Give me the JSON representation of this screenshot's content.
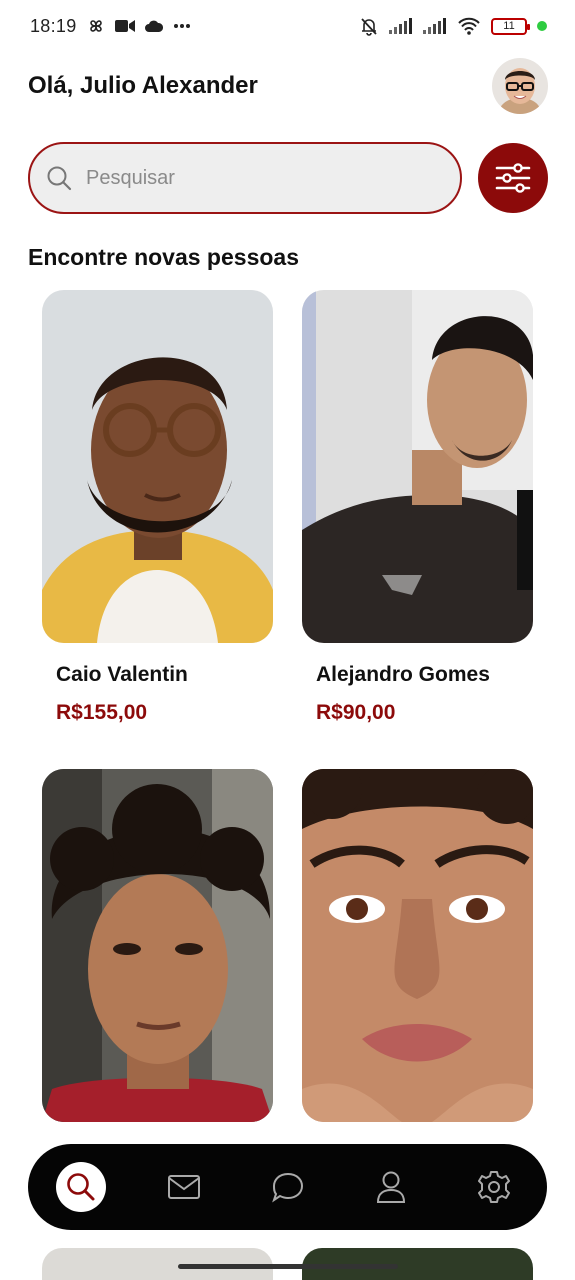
{
  "status_bar": {
    "time": "18:19",
    "left_icons": [
      "pinwheel-icon",
      "video-icon",
      "cloud-icon",
      "more-icon"
    ],
    "right_icons": [
      "bell-off-icon",
      "signal-icon",
      "signal-icon",
      "wifi-icon"
    ],
    "battery": "11"
  },
  "header": {
    "greeting": "Olá, Julio Alexander",
    "avatar_icon": "user-avatar"
  },
  "search": {
    "placeholder": "Pesquisar",
    "search_icon": "search-icon",
    "filter_icon": "sliders-icon"
  },
  "section": {
    "title": "Encontre novas pessoas"
  },
  "people": [
    {
      "name": "Caio Valentin",
      "price": "R$155,00"
    },
    {
      "name": "Alejandro Gomes",
      "price": "R$90,00"
    },
    {
      "name": "",
      "price": ""
    },
    {
      "name": "",
      "price": ""
    }
  ],
  "nav": {
    "items": [
      "search-icon",
      "mail-icon",
      "chat-icon",
      "profile-icon",
      "settings-icon"
    ],
    "active": "search-icon"
  },
  "colors": {
    "accent": "#8c0a0a",
    "nav_bg": "#050505",
    "search_bg": "#eeeeee"
  }
}
